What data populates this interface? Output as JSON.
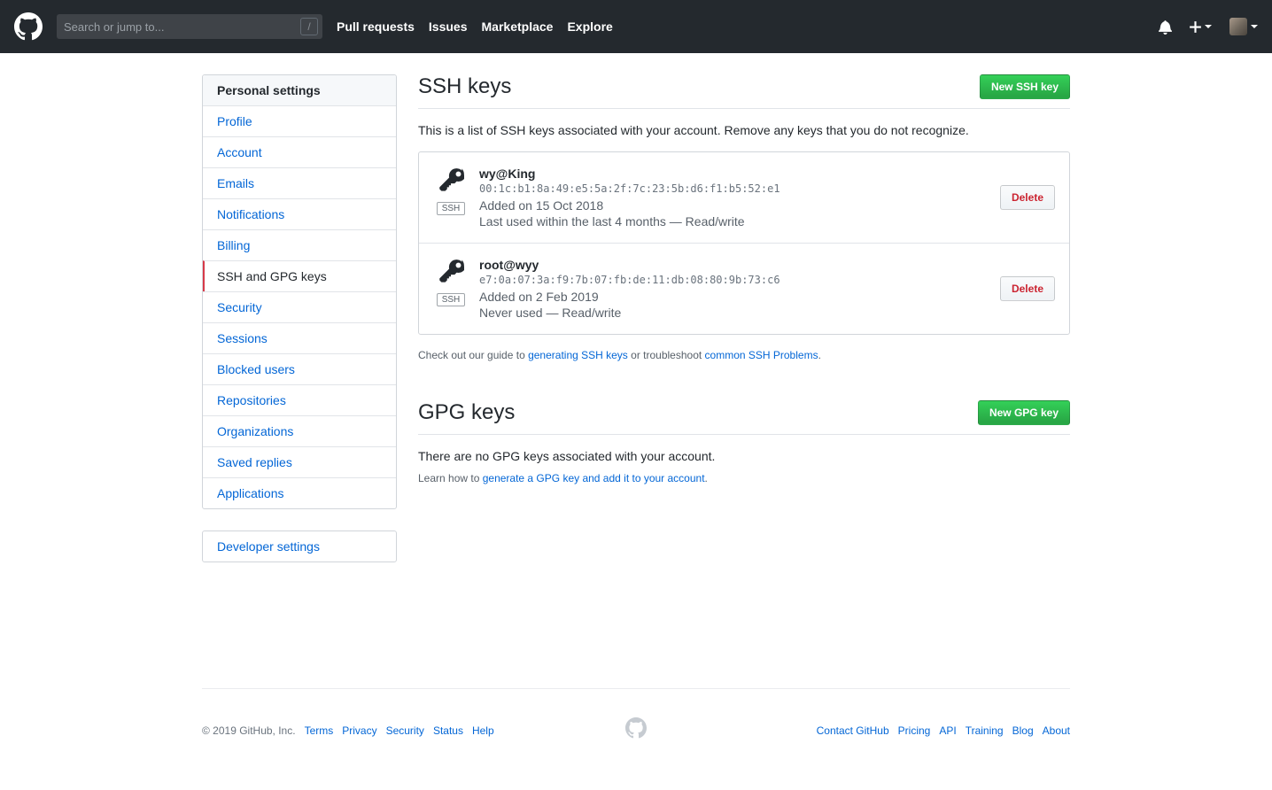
{
  "colors": {
    "header_bg": "#24292e",
    "link_blue": "#0366d6",
    "button_green": "#28a745",
    "danger_red": "#cb2431",
    "selected_border": "#d73a49"
  },
  "header": {
    "search_placeholder": "Search or jump to...",
    "slash_hint": "/",
    "nav": [
      "Pull requests",
      "Issues",
      "Marketplace",
      "Explore"
    ]
  },
  "sidebar": {
    "personal_settings_title": "Personal settings",
    "items": [
      {
        "label": "Profile"
      },
      {
        "label": "Account"
      },
      {
        "label": "Emails"
      },
      {
        "label": "Notifications"
      },
      {
        "label": "Billing"
      },
      {
        "label": "SSH and GPG keys"
      },
      {
        "label": "Security"
      },
      {
        "label": "Sessions"
      },
      {
        "label": "Blocked users"
      },
      {
        "label": "Repositories"
      },
      {
        "label": "Organizations"
      },
      {
        "label": "Saved replies"
      },
      {
        "label": "Applications"
      }
    ],
    "developer_settings_label": "Developer settings"
  },
  "ssh_section": {
    "title": "SSH keys",
    "new_button": "New SSH key",
    "description": "This is a list of SSH keys associated with your account. Remove any keys that you do not recognize.",
    "keys": [
      {
        "name": "wy@King",
        "fingerprint": "00:1c:b1:8a:49:e5:5a:2f:7c:23:5b:d6:f1:b5:52:e1",
        "added": "Added on 15 Oct 2018",
        "usage": "Last used within the last 4 months — Read/write",
        "badge": "SSH",
        "delete_label": "Delete"
      },
      {
        "name": "root@wyy",
        "fingerprint": "e7:0a:07:3a:f9:7b:07:fb:de:11:db:08:80:9b:73:c6",
        "added": "Added on 2 Feb 2019",
        "usage": "Never used — Read/write",
        "badge": "SSH",
        "delete_label": "Delete"
      }
    ],
    "help_prefix": "Check out our guide to ",
    "help_link1": "generating SSH keys",
    "help_middle": " or troubleshoot ",
    "help_link2": "common SSH Problems",
    "help_suffix": "."
  },
  "gpg_section": {
    "title": "GPG keys",
    "new_button": "New GPG key",
    "empty_text": "There are no GPG keys associated with your account.",
    "help_prefix": "Learn how to ",
    "help_link": "generate a GPG key and add it to your account",
    "help_suffix": "."
  },
  "footer": {
    "copyright": "© 2019 GitHub, Inc.",
    "left_links": [
      "Terms",
      "Privacy",
      "Security",
      "Status",
      "Help"
    ],
    "right_links": [
      "Contact GitHub",
      "Pricing",
      "API",
      "Training",
      "Blog",
      "About"
    ]
  }
}
